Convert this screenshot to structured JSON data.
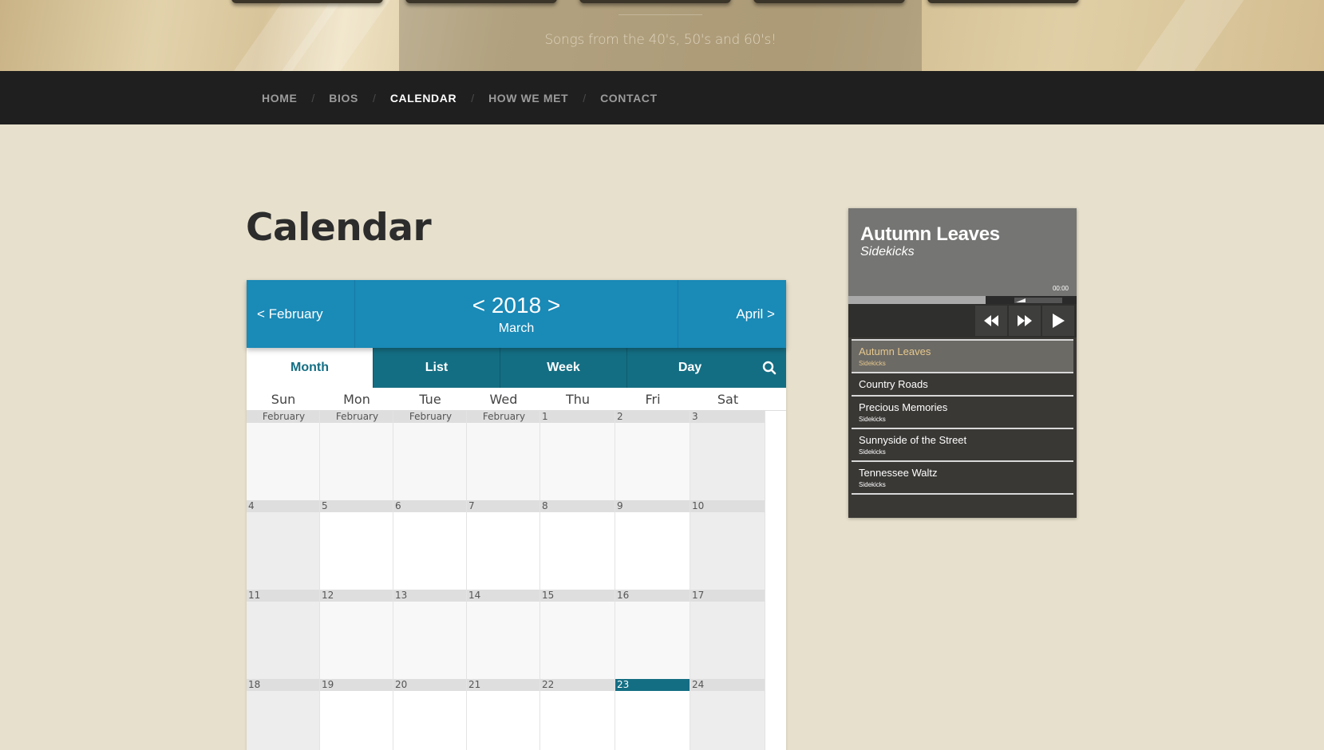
{
  "header": {
    "tagline": "Songs from the 40's, 50's and 60's!"
  },
  "nav": {
    "items": [
      {
        "label": "HOME",
        "active": false
      },
      {
        "label": "BIOS",
        "active": false
      },
      {
        "label": "CALENDAR",
        "active": true
      },
      {
        "label": "HOW WE MET",
        "active": false
      },
      {
        "label": "CONTACT",
        "active": false
      }
    ],
    "separator": "/"
  },
  "page": {
    "title": "Calendar"
  },
  "calendar": {
    "prev_label": "< February",
    "next_label": "April >",
    "year_label": "< 2018 >",
    "month_label": "March",
    "tabs": [
      {
        "label": "Month",
        "active": true
      },
      {
        "label": "List",
        "active": false
      },
      {
        "label": "Week",
        "active": false
      },
      {
        "label": "Day",
        "active": false
      }
    ],
    "search_icon": "search-icon",
    "weekdays": [
      "Sun",
      "Mon",
      "Tue",
      "Wed",
      "Thu",
      "Fri",
      "Sat"
    ],
    "weeks": [
      [
        "February",
        "February",
        "February",
        "February",
        "1",
        "2",
        "3"
      ],
      [
        "4",
        "5",
        "6",
        "7",
        "8",
        "9",
        "10"
      ],
      [
        "11",
        "12",
        "13",
        "14",
        "15",
        "16",
        "17"
      ],
      [
        "18",
        "19",
        "20",
        "21",
        "22",
        "23",
        "24"
      ]
    ],
    "today": "23",
    "colors": {
      "header": "#1a8ab7",
      "tabs": "#146e83"
    }
  },
  "player": {
    "current_title": "Autumn Leaves",
    "current_artist": "Sidekicks",
    "time": "00:00",
    "progress": 0.6,
    "controls": [
      "rewind-icon",
      "fast-forward-icon",
      "play-icon"
    ],
    "playlist": [
      {
        "title": "Autumn Leaves",
        "artist": "Sidekicks",
        "active": true
      },
      {
        "title": "Country Roads",
        "artist": "",
        "active": false
      },
      {
        "title": "Precious Memories",
        "artist": "Sidekicks",
        "active": false
      },
      {
        "title": "Sunnyside of the Street",
        "artist": "Sidekicks",
        "active": false
      },
      {
        "title": "Tennessee Waltz",
        "artist": "Sidekicks",
        "active": false
      }
    ]
  }
}
